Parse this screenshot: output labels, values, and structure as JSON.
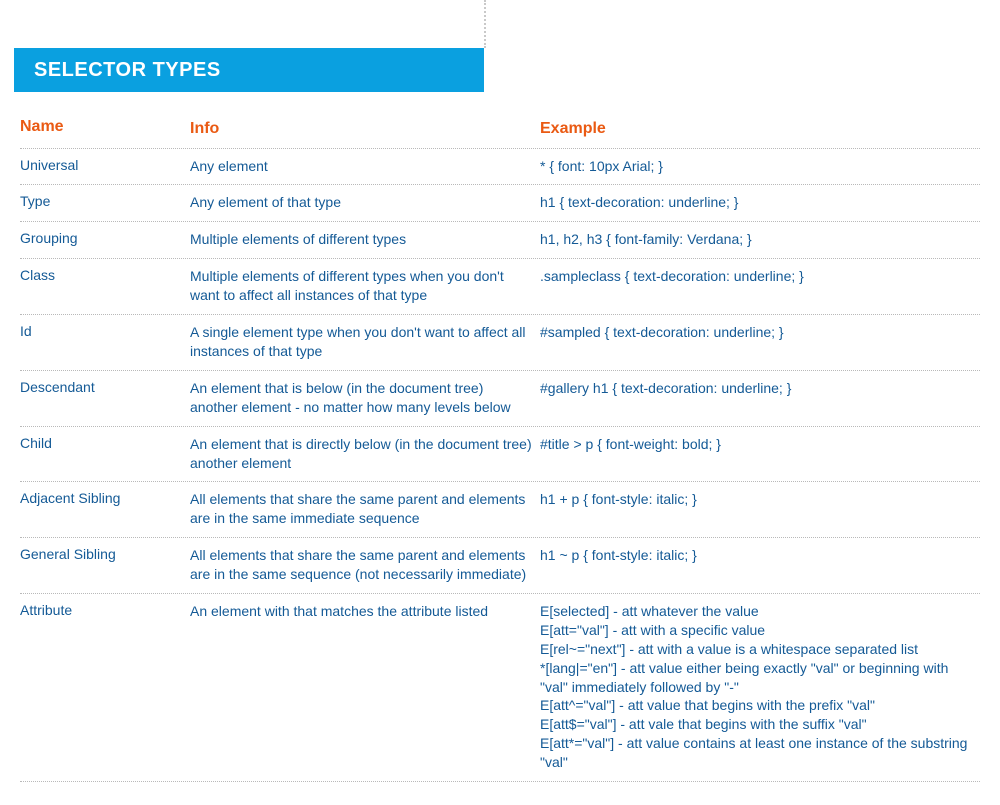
{
  "banner": {
    "title": "SELECTOR TYPES"
  },
  "headers": {
    "name": "Name",
    "info": "Info",
    "example": "Example"
  },
  "rows": [
    {
      "name": "Universal",
      "info": "Any element",
      "example": "* { font: 10px Arial; }"
    },
    {
      "name": "Type",
      "info": "Any element of that type",
      "example": "h1 { text-decoration: underline; }"
    },
    {
      "name": "Grouping",
      "info": "Multiple elements of different types",
      "example": "h1, h2, h3 { font-family: Verdana; }"
    },
    {
      "name": "Class",
      "info": "Multiple elements of different types when you don't want to affect all instances of that type",
      "example": ".sampleclass { text-decoration: underline; }"
    },
    {
      "name": "Id",
      "info": "A single element type when you don't want to affect all instances of that type",
      "example": "#sampled { text-decoration: underline; }"
    },
    {
      "name": "Descendant",
      "info": "An element that is below (in the document tree) another element - no matter how many levels below",
      "example": "#gallery h1 { text-decoration: underline; }"
    },
    {
      "name": "Child",
      "info": "An element that is directly below (in the document tree) another element",
      "example": "#title > p { font-weight: bold; }"
    },
    {
      "name": "Adjacent Sibling",
      "info": "All elements that share the same parent and elements are in the same immediate sequence",
      "example": "h1 + p { font-style: italic; }"
    },
    {
      "name": "General Sibling",
      "info": "All elements that share the same parent and elements are in the same sequence\n(not necessarily immediate)",
      "example": "h1 ~ p { font-style: italic; }"
    },
    {
      "name": "Attribute",
      "info": "An element with that matches the attribute listed",
      "example": "E[selected] - att whatever the value\nE[att=\"val\"] - att with a specific value\nE[rel~=\"next\"] - att with a value is a whitespace separated list\n*[lang|=\"en\"] - att value either being exactly \"val\" or beginning with \"val\" immediately followed by \"-\"\nE[att^=\"val\"] - att value that begins with the prefix \"val\"\nE[att$=\"val\"] - att vale that begins with the suffix \"val\"\nE[att*=\"val\"] - att value contains at least one instance of the substring \"val\""
    }
  ]
}
